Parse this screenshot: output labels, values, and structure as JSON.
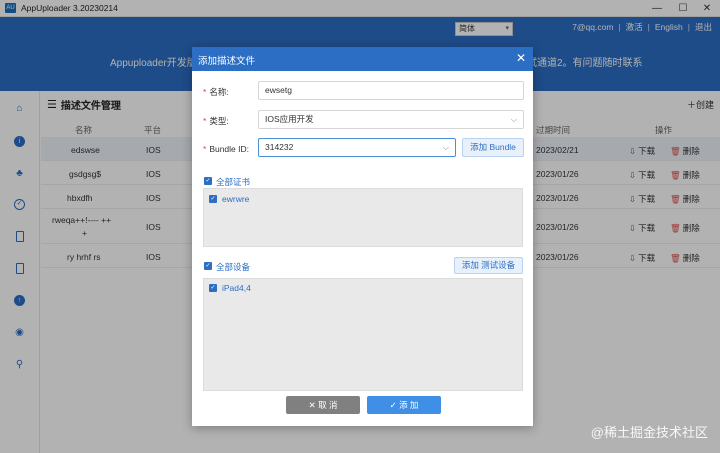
{
  "window": {
    "title": "AppUploader 3.20230214",
    "icon": "AU",
    "minimize": "—",
    "maximize": "☐",
    "close": "✕"
  },
  "header": {
    "lang_select": "简体",
    "email_suffix": "7@qq.com",
    "activate": "激活",
    "language": "English",
    "logout": "退出",
    "banner_left": "Appuploader开发版",
    "banner_right": "试通道2。有问题随时联系"
  },
  "sidebar": {
    "icons": [
      "home-icon",
      "info-icon",
      "apps-icon",
      "check-icon",
      "device-icon",
      "document-icon",
      "upload-icon",
      "eye-icon",
      "location-icon"
    ]
  },
  "main": {
    "section_title": "描述文件管理",
    "create_label": "创建",
    "columns": {
      "name": "名称",
      "platform": "平台",
      "expiry": "过期时间",
      "action": "操作"
    },
    "download_label": "下载",
    "delete_label": "删除",
    "rows": [
      {
        "name": "edswse",
        "platform": "IOS",
        "expiry": "2023/02/21",
        "selected": true
      },
      {
        "name": "gsdgsg$",
        "platform": "IOS",
        "expiry": "2023/01/26",
        "selected": false
      },
      {
        "name": "hbxdfh",
        "platform": "IOS",
        "expiry": "2023/01/26",
        "selected": false
      },
      {
        "name": "rweqa++!---- ++",
        "name2": "+",
        "platform": "IOS",
        "expiry": "2023/01/26",
        "selected": false
      },
      {
        "name": "ry hrhf rs",
        "platform": "IOS",
        "expiry": "2023/01/26",
        "selected": false
      }
    ]
  },
  "modal": {
    "title": "添加描述文件",
    "close": "✕",
    "name_label": "名称:",
    "name_value": "ewsetg",
    "type_label": "类型:",
    "type_value": "IOS应用开发",
    "bundle_label": "Bundle ID:",
    "bundle_value": "314232",
    "add_bundle": "添加 Bundle",
    "all_certs": "全部证书",
    "cert_item": "ewrwre",
    "all_devices": "全部设备",
    "add_device": "添加 测试设备",
    "device_item": "iPad4,4",
    "cancel": "取 消",
    "add": "添 加",
    "cancel_icon": "✕",
    "add_icon": "✓"
  },
  "watermark": "@稀土掘金技术社区"
}
